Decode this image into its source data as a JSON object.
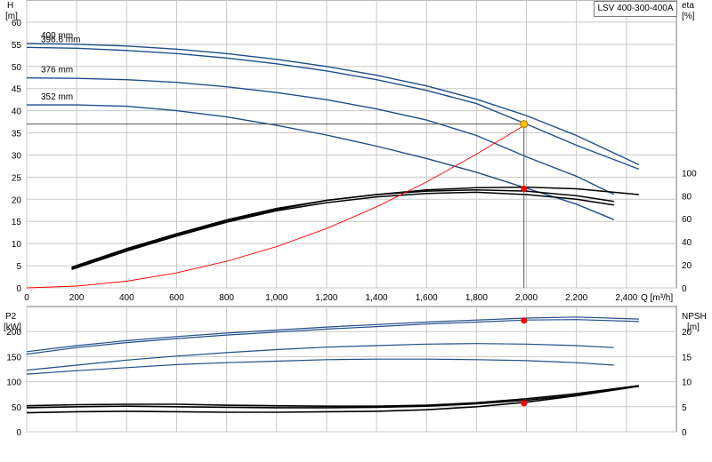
{
  "model": "LSV 400-300-400A",
  "colors": {
    "head": "#1f4e8c",
    "efficiency": "#000000",
    "system": "#ff0000",
    "duty_point": "#ffc000",
    "marker": "#ff0000",
    "grid": "#c8c8c8"
  },
  "chart_data": [
    {
      "type": "line",
      "axes": {
        "x": {
          "label": "Q [m³/h]",
          "lim": [
            0,
            2600
          ],
          "ticks": [
            0,
            200,
            400,
            600,
            800,
            1000,
            1200,
            1400,
            1600,
            1800,
            2000,
            2200,
            2400
          ],
          "tick_labels": [
            "0",
            "200",
            "400",
            "600",
            "800",
            "1,000",
            "1,200",
            "1,400",
            "1,600",
            "1,800",
            "2,000",
            "2,200",
            "2,400"
          ]
        },
        "y_left": {
          "label_top": "H",
          "label_unit": "[m]",
          "lim": [
            0,
            65
          ],
          "ticks": [
            0,
            5,
            10,
            15,
            20,
            25,
            30,
            35,
            40,
            45,
            50,
            55,
            60
          ]
        },
        "y_right": {
          "label_top": "eta",
          "label_unit": "[%]",
          "lim": [
            0,
            250
          ],
          "ticks": [
            0,
            20,
            40,
            60,
            80,
            100
          ]
        }
      },
      "grid": true,
      "series": [
        {
          "name": "400 mm",
          "kind": "head",
          "axis": "left",
          "points": [
            [
              0,
              55.2
            ],
            [
              200,
              55.0
            ],
            [
              400,
              54.6
            ],
            [
              600,
              53.9
            ],
            [
              800,
              52.9
            ],
            [
              1000,
              51.6
            ],
            [
              1200,
              50.0
            ],
            [
              1400,
              48.0
            ],
            [
              1600,
              45.6
            ],
            [
              1800,
              42.6
            ],
            [
              2000,
              38.9
            ],
            [
              2200,
              34.4
            ],
            [
              2450,
              27.8
            ]
          ]
        },
        {
          "name": "396.6 mm",
          "kind": "head",
          "axis": "left",
          "points": [
            [
              0,
              54.3
            ],
            [
              200,
              54.1
            ],
            [
              400,
              53.6
            ],
            [
              600,
              52.9
            ],
            [
              800,
              51.9
            ],
            [
              1000,
              50.6
            ],
            [
              1200,
              49.0
            ],
            [
              1400,
              47.0
            ],
            [
              1600,
              44.6
            ],
            [
              1800,
              41.6
            ],
            [
              2000,
              37.0
            ],
            [
              2200,
              32.2
            ],
            [
              2450,
              26.8
            ]
          ]
        },
        {
          "name": "376 mm",
          "kind": "head",
          "axis": "left",
          "points": [
            [
              0,
              47.4
            ],
            [
              200,
              47.3
            ],
            [
              400,
              47.0
            ],
            [
              600,
              46.4
            ],
            [
              800,
              45.4
            ],
            [
              1000,
              44.1
            ],
            [
              1200,
              42.5
            ],
            [
              1400,
              40.4
            ],
            [
              1600,
              37.9
            ],
            [
              1800,
              34.4
            ],
            [
              2000,
              29.6
            ],
            [
              2200,
              25.2
            ],
            [
              2350,
              21.1
            ]
          ]
        },
        {
          "name": "352 mm",
          "kind": "head",
          "axis": "left",
          "points": [
            [
              0,
              41.3
            ],
            [
              200,
              41.3
            ],
            [
              400,
              41.0
            ],
            [
              600,
              40.0
            ],
            [
              800,
              38.6
            ],
            [
              1000,
              36.7
            ],
            [
              1200,
              34.5
            ],
            [
              1400,
              32.0
            ],
            [
              1600,
              29.2
            ],
            [
              1800,
              26.1
            ],
            [
              2000,
              22.5
            ],
            [
              2200,
              18.9
            ],
            [
              2350,
              15.4
            ]
          ]
        },
        {
          "name": "",
          "kind": "efficiency",
          "axis": "right",
          "points": [
            [
              180,
              17
            ],
            [
              400,
              33
            ],
            [
              600,
              46
            ],
            [
              800,
              58
            ],
            [
              1000,
              68
            ],
            [
              1200,
              76
            ],
            [
              1400,
              81
            ],
            [
              1600,
              85
            ],
            [
              1800,
              87
            ],
            [
              2000,
              87.5
            ],
            [
              2200,
              86
            ],
            [
              2450,
              81
            ]
          ]
        },
        {
          "name": "",
          "kind": "efficiency",
          "axis": "right",
          "points": [
            [
              180,
              18
            ],
            [
              400,
              34
            ],
            [
              600,
              47
            ],
            [
              800,
              59
            ],
            [
              1000,
              69
            ],
            [
              1200,
              76
            ],
            [
              1400,
              81
            ],
            [
              1600,
              84
            ],
            [
              1800,
              85
            ],
            [
              2000,
              84
            ],
            [
              2200,
              80
            ],
            [
              2350,
              75
            ]
          ]
        },
        {
          "name": "",
          "kind": "efficiency",
          "axis": "right",
          "points": [
            [
              180,
              16
            ],
            [
              400,
              32
            ],
            [
              600,
              45
            ],
            [
              800,
              57
            ],
            [
              1000,
              67
            ],
            [
              1200,
              74
            ],
            [
              1400,
              79
            ],
            [
              1600,
              82
            ],
            [
              1800,
              83
            ],
            [
              2000,
              81
            ],
            [
              2200,
              77
            ],
            [
              2350,
              72
            ]
          ]
        },
        {
          "name": "",
          "kind": "system",
          "axis": "left",
          "points": [
            [
              0,
              0
            ],
            [
              200,
              0.4
            ],
            [
              400,
              1.5
            ],
            [
              600,
              3.4
            ],
            [
              800,
              6.0
            ],
            [
              1000,
              9.3
            ],
            [
              1200,
              13.4
            ],
            [
              1400,
              18.3
            ],
            [
              1600,
              23.9
            ],
            [
              1800,
              30.2
            ],
            [
              2000,
              37.0
            ]
          ]
        }
      ],
      "duty_point": {
        "x": 1990,
        "y": 37.0,
        "label": ""
      },
      "markers": [
        {
          "x": 1990,
          "y": 22.4,
          "axis": "left"
        }
      ]
    },
    {
      "type": "line",
      "axes": {
        "x": {
          "lim": [
            0,
            2600
          ]
        },
        "y_left": {
          "label_top": "P2",
          "label_unit": "[kW]",
          "lim": [
            0,
            250
          ],
          "ticks": [
            0,
            50,
            100,
            150,
            200
          ]
        },
        "y_right": {
          "label_top": "NPSH",
          "label_unit": "[m]",
          "lim": [
            0,
            25
          ],
          "ticks": [
            0,
            5,
            10,
            15,
            20
          ]
        }
      },
      "grid": true,
      "series": [
        {
          "name": "",
          "kind": "power",
          "axis": "left",
          "points": [
            [
              0,
              160
            ],
            [
              200,
              172
            ],
            [
              400,
              182
            ],
            [
              600,
              190
            ],
            [
              800,
              197
            ],
            [
              1000,
              203
            ],
            [
              1200,
              209
            ],
            [
              1400,
              214
            ],
            [
              1600,
              219
            ],
            [
              1800,
              223
            ],
            [
              2000,
              227
            ],
            [
              2200,
              229
            ],
            [
              2450,
              225
            ]
          ]
        },
        {
          "name": "",
          "kind": "power",
          "axis": "left",
          "points": [
            [
              0,
              155
            ],
            [
              200,
              168
            ],
            [
              400,
              178
            ],
            [
              600,
              186
            ],
            [
              800,
              193
            ],
            [
              1000,
              199
            ],
            [
              1200,
              205
            ],
            [
              1400,
              210
            ],
            [
              1600,
              215
            ],
            [
              1800,
              219
            ],
            [
              2000,
              223
            ],
            [
              2200,
              224
            ],
            [
              2450,
              220
            ]
          ]
        },
        {
          "name": "",
          "kind": "power",
          "axis": "left",
          "points": [
            [
              0,
              123
            ],
            [
              200,
              133
            ],
            [
              400,
              143
            ],
            [
              600,
              151
            ],
            [
              800,
              158
            ],
            [
              1000,
              164
            ],
            [
              1200,
              169
            ],
            [
              1400,
              172
            ],
            [
              1600,
              175
            ],
            [
              1800,
              176
            ],
            [
              2000,
              175
            ],
            [
              2200,
              172
            ],
            [
              2350,
              168
            ]
          ]
        },
        {
          "name": "",
          "kind": "power",
          "axis": "left",
          "points": [
            [
              0,
              115
            ],
            [
              200,
              122
            ],
            [
              400,
              128
            ],
            [
              600,
              134
            ],
            [
              800,
              138
            ],
            [
              1000,
              141
            ],
            [
              1200,
              144
            ],
            [
              1400,
              145
            ],
            [
              1600,
              145
            ],
            [
              1800,
              144
            ],
            [
              2000,
              142
            ],
            [
              2200,
              138
            ],
            [
              2350,
              133
            ]
          ]
        },
        {
          "name": "",
          "kind": "npsh",
          "axis": "right",
          "points": [
            [
              0,
              5.2
            ],
            [
              200,
              5.4
            ],
            [
              400,
              5.5
            ],
            [
              600,
              5.5
            ],
            [
              800,
              5.3
            ],
            [
              1000,
              5.2
            ],
            [
              1200,
              5.1
            ],
            [
              1400,
              5.1
            ],
            [
              1600,
              5.3
            ],
            [
              1800,
              5.8
            ],
            [
              2000,
              6.6
            ],
            [
              2200,
              7.6
            ],
            [
              2450,
              9.2
            ]
          ]
        },
        {
          "name": "",
          "kind": "npsh",
          "axis": "right",
          "points": [
            [
              0,
              4.8
            ],
            [
              200,
              5.0
            ],
            [
              400,
              5.1
            ],
            [
              600,
              5.0
            ],
            [
              800,
              4.9
            ],
            [
              1000,
              4.8
            ],
            [
              1200,
              4.8
            ],
            [
              1400,
              4.9
            ],
            [
              1600,
              5.1
            ],
            [
              1800,
              5.6
            ],
            [
              2000,
              6.3
            ],
            [
              2200,
              7.3
            ],
            [
              2350,
              8.5
            ]
          ]
        },
        {
          "name": "",
          "kind": "npsh",
          "axis": "right",
          "points": [
            [
              0,
              3.8
            ],
            [
              200,
              4.0
            ],
            [
              400,
              4.1
            ],
            [
              600,
              4.0
            ],
            [
              800,
              3.9
            ],
            [
              1000,
              3.9
            ],
            [
              1200,
              4.0
            ],
            [
              1400,
              4.1
            ],
            [
              1600,
              4.4
            ],
            [
              1800,
              5.0
            ],
            [
              2000,
              5.9
            ],
            [
              2200,
              7.2
            ],
            [
              2450,
              9.1
            ]
          ]
        }
      ],
      "markers": [
        {
          "x": 1990,
          "y": 222,
          "axis": "left"
        },
        {
          "x": 1990,
          "y": 5.7,
          "axis": "right"
        }
      ]
    }
  ]
}
